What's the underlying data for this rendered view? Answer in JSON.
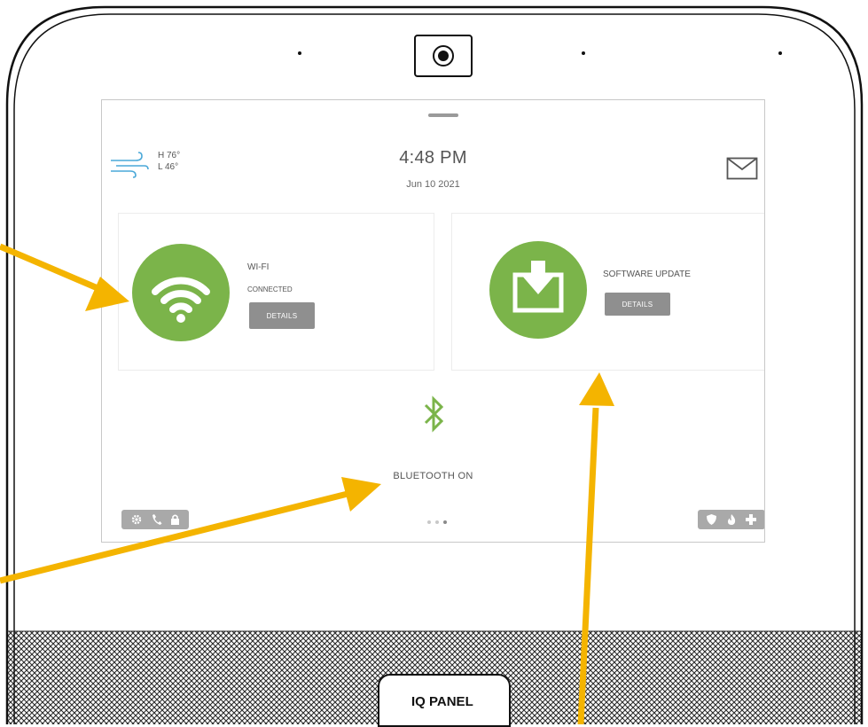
{
  "colors": {
    "accent_green": "#7bb44a",
    "arrow_orange": "#f4b400",
    "button_gray": "#8f8f8f"
  },
  "weather": {
    "icon": "wind-icon",
    "high": "H 76°",
    "low": "L 46°"
  },
  "clock": {
    "time": "4:48 PM",
    "date": "Jun 10 2021"
  },
  "messages": {
    "icon": "envelope-icon"
  },
  "wifi_card": {
    "icon": "wifi-icon",
    "title": "WI-FI",
    "status": "CONNECTED",
    "details_label": "DETAILS"
  },
  "update_card": {
    "icon": "download-box-icon",
    "title": "SOFTWARE UPDATE",
    "details_label": "DETAILS"
  },
  "bluetooth": {
    "icon": "bluetooth-icon",
    "label": "BLUETOOTH ON"
  },
  "quick_left": {
    "icons": [
      "settings-icon",
      "phone-icon",
      "lock-icon"
    ]
  },
  "quick_right": {
    "icons": [
      "shield-icon",
      "fire-icon",
      "medical-cross-icon"
    ]
  },
  "pager": {
    "count": 3,
    "active_index": 2
  },
  "hardware": {
    "camera_icon": "camera-icon",
    "logo": "IQ PANEL"
  }
}
